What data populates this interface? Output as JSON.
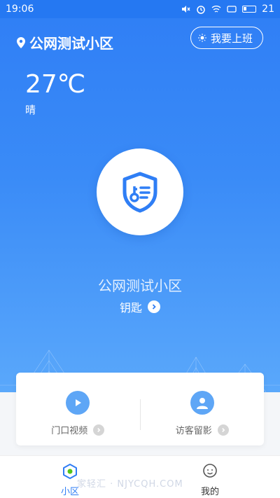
{
  "status_bar": {
    "time": "19:06",
    "battery_level": "21"
  },
  "header": {
    "community": "公网测试小区",
    "work_button": "我要上班"
  },
  "weather": {
    "temperature": "27℃",
    "condition": "晴"
  },
  "key_section": {
    "community_name": "公网测试小区",
    "key_label": "钥匙"
  },
  "panel": {
    "items": [
      {
        "label": "门口视频",
        "icon": "play-icon"
      },
      {
        "label": "访客留影",
        "icon": "person-icon"
      }
    ]
  },
  "tabs": [
    {
      "label": "小区",
      "icon": "community-icon",
      "active": true
    },
    {
      "label": "我的",
      "icon": "profile-icon",
      "active": false
    }
  ],
  "watermark": "家轻汇 · NJYCQH.COM",
  "colors": {
    "primary": "#2f7ef5",
    "panel_icon": "#5ea6f6"
  }
}
